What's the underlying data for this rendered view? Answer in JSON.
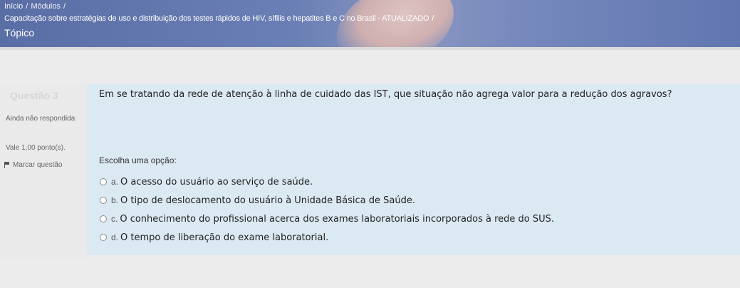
{
  "header": {
    "breadcrumb": {
      "home": "Início",
      "sep1": "/",
      "modules": "Módulos",
      "sep2": "/"
    },
    "course_title": "Capacitação sobre estratégias de uso e distribuição dos testes rápidos de HIV, sífilis e hepatites B e C no Brasil - ATUALIZADO",
    "course_sep": "/",
    "page_title": "Tópico"
  },
  "question_info": {
    "number_label": "Questão 3",
    "state": "Ainda não respondida",
    "grade": "Vale 1,00 ponto(s).",
    "flag_label": "Marcar questão"
  },
  "question": {
    "text": "Em se tratando da rede de atenção à linha de cuidado das IST, que situação não agrega valor para a redução dos agravos?",
    "prompt": "Escolha uma opção:",
    "options": [
      {
        "letter": "a.",
        "text": "O acesso do usuário ao serviço de saúde."
      },
      {
        "letter": "b.",
        "text": "O tipo de deslocamento do usuário à Unidade Básica de Saúde."
      },
      {
        "letter": "c.",
        "text": "O conhecimento do profissional acerca dos exames laboratoriais incorporados à rede do SUS."
      },
      {
        "letter": "d.",
        "text": "O tempo de liberação do exame laboratorial."
      }
    ]
  },
  "colors": {
    "header_bg": "#6a7fb5",
    "formulation_bg": "#dbe9f3",
    "info_bg": "#eaeaea"
  }
}
